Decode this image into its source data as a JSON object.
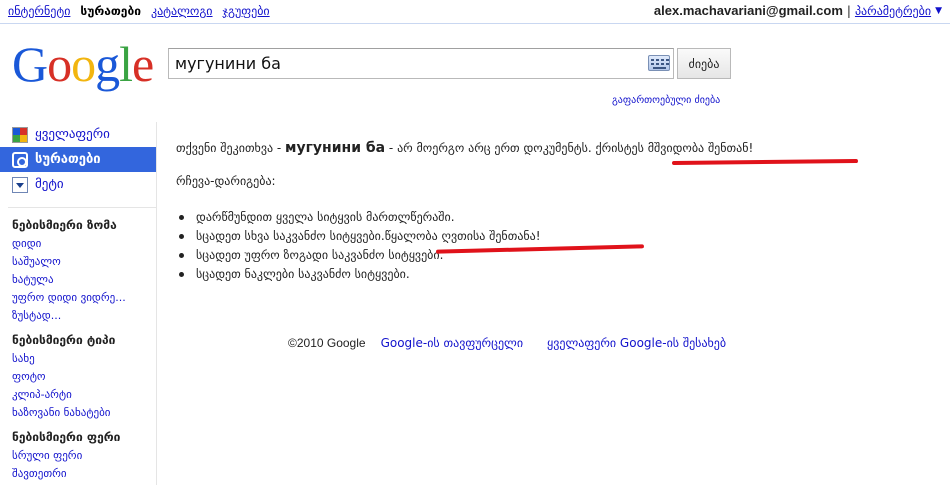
{
  "topnav": {
    "items": [
      "ინტერნეტი",
      "სურათები",
      "კატალოგი",
      "ჯგუფები"
    ],
    "active_index": 1
  },
  "account": {
    "email": "alex.machavariani@gmail.com",
    "separator": "|",
    "settings_label": "პარამეტრები",
    "menu_icon": "chevron-down-icon"
  },
  "logo": {
    "text": "Google"
  },
  "search": {
    "query": "мугунини ба",
    "button_label": "ძიება",
    "keyboard_icon": "keyboard-icon",
    "advanced_label": "გაფართოებული ძიება"
  },
  "sidebar": {
    "nav": [
      {
        "label": "ყველაფერი",
        "icon": "google-multicolor-icon",
        "selected": false
      },
      {
        "label": "სურათები",
        "icon": "camera-icon",
        "selected": true
      },
      {
        "label": "მეტი",
        "icon": "dropdown-icon",
        "selected": false
      }
    ],
    "groups": [
      {
        "heading": "ნებისმიერი ზომა",
        "links": [
          "დიდი",
          "საშუალო",
          "ხატულა",
          "უფრო დიდი ვიდრე...",
          "ზუსტად..."
        ]
      },
      {
        "heading": "ნებისმიერი ტიპი",
        "links": [
          "სახე",
          "ფოტო",
          "კლიპ-არტი",
          "ხაზოვანი ნახატები"
        ]
      },
      {
        "heading": "ნებისმიერი ფერი",
        "links": [
          "სრული ფერი",
          "შავთეთრი"
        ]
      }
    ]
  },
  "results": {
    "msg_prefix": "თქვენი შეკითხვა - ",
    "msg_query": "мугунини ба",
    "msg_suffix": " - არ მოერგო არც ერთ დოკუმენტს. ",
    "msg_annotation": "ქრისტეს მშვიდობა შენთან!",
    "suggestions_heading": "რჩევა-დარიგება:",
    "suggestions": [
      "დარწმუნდით ყველა სიტყვის მართლწერაში.",
      "სცადეთ სხვა საკვანძო სიტყვები.",
      "სცადეთ უფრო ზოგადი საკვანძო სიტყვები.",
      "სცადეთ ნაკლები საკვანძო სიტყვები."
    ],
    "suggestion2_annotation": "წყალობა ღვთისა შენთანა!",
    "annotation_color": "#e0121a"
  },
  "footer": {
    "copyright": "©2010 Google",
    "links": [
      "Google-ის თავფურცელი",
      "ყველაფერი Google-ის შესახებ"
    ]
  },
  "colors": {
    "link": "#1111cc",
    "selected_bg": "#3366dd",
    "rule": "#c9d7f1"
  }
}
